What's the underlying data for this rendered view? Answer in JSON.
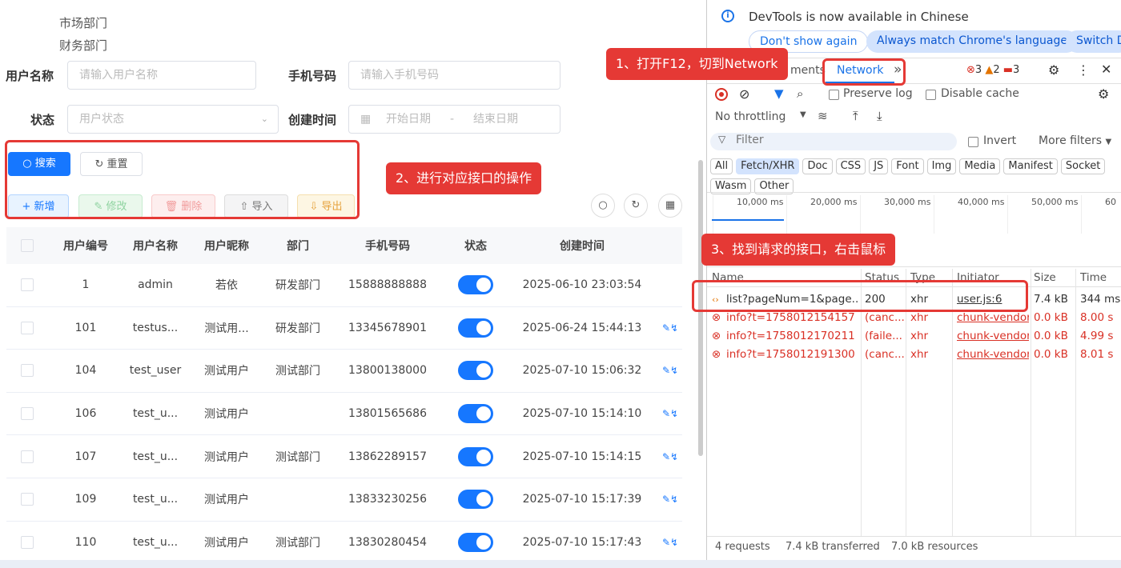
{
  "tree": {
    "items": [
      "市场部门",
      "财务部门"
    ]
  },
  "form": {
    "username_label": "用户名称",
    "username_placeholder": "请输入用户名称",
    "phone_label": "手机号码",
    "phone_placeholder": "请输入手机号码",
    "status_label": "状态",
    "status_placeholder": "用户状态",
    "created_label": "创建时间",
    "start_placeholder": "开始日期",
    "date_sep": "-",
    "end_placeholder": "结束日期"
  },
  "buttons": {
    "search": "搜索",
    "reset": "重置",
    "add": "新增",
    "edit": "修改",
    "delete": "删除",
    "import": "导入",
    "export": "导出"
  },
  "callouts": {
    "step1": "1、打开F12，切到Network",
    "step2": "2、进行对应接口的操作",
    "step3": "3、找到请求的接口，右击鼠标"
  },
  "table": {
    "headers": [
      "用户编号",
      "用户名称",
      "用户昵称",
      "部门",
      "手机号码",
      "状态",
      "创建时间"
    ],
    "rows": [
      {
        "id": "1",
        "name": "admin",
        "nick": "若依",
        "dept": "研发部门",
        "phone": "15888888888",
        "time": "2025-06-10 23:03:54"
      },
      {
        "id": "101",
        "name": "testus...",
        "nick": "测试用...",
        "dept": "研发部门",
        "phone": "13345678901",
        "time": "2025-06-24 15:44:13"
      },
      {
        "id": "104",
        "name": "test_user",
        "nick": "测试用户",
        "dept": "测试部门",
        "phone": "13800138000",
        "time": "2025-07-10 15:06:32"
      },
      {
        "id": "106",
        "name": "test_u...",
        "nick": "测试用户",
        "dept": "",
        "phone": "13801565686",
        "time": "2025-07-10 15:14:10"
      },
      {
        "id": "107",
        "name": "test_u...",
        "nick": "测试用户",
        "dept": "测试部门",
        "phone": "13862289157",
        "time": "2025-07-10 15:14:15"
      },
      {
        "id": "109",
        "name": "test_u...",
        "nick": "测试用户",
        "dept": "",
        "phone": "13833230256",
        "time": "2025-07-10 15:17:39"
      },
      {
        "id": "110",
        "name": "test_u...",
        "nick": "测试用户",
        "dept": "测试部门",
        "phone": "13830280454",
        "time": "2025-07-10 15:17:43"
      }
    ]
  },
  "devtools": {
    "banner": "DevTools is now available in Chinese",
    "dont_show": "Don't show again",
    "always_match": "Always match Chrome's language",
    "switch": "Switch D",
    "tab_elements_partial": "ments",
    "tab_network": "Network",
    "more_tabs": "»",
    "errors": "3",
    "warnings": "2",
    "messages": "3",
    "preserve_log": "Preserve log",
    "disable_cache": "Disable cache",
    "throttling": "No throttling",
    "filter_placeholder": "Filter",
    "invert": "Invert",
    "more_filters": "More filters",
    "type_filters": [
      "All",
      "Fetch/XHR",
      "Doc",
      "CSS",
      "JS",
      "Font",
      "Img",
      "Media",
      "Manifest",
      "Socket",
      "Wasm",
      "Other"
    ],
    "timeline_ticks": [
      "10,000 ms",
      "20,000 ms",
      "30,000 ms",
      "40,000 ms",
      "50,000 ms",
      "60"
    ],
    "columns": [
      "Name",
      "Status",
      "Type",
      "Initiator",
      "Size",
      "Time"
    ],
    "requests": [
      {
        "name": "list?pageNum=1&page...",
        "status": "200",
        "type": "xhr",
        "initiator": "user.js:6",
        "size": "7.4 kB",
        "time": "344 ms",
        "error": false
      },
      {
        "name": "info?t=1758012154157",
        "status": "(canc...",
        "type": "xhr",
        "initiator": "chunk-vendors",
        "size": "0.0 kB",
        "time": "8.00 s",
        "error": true
      },
      {
        "name": "info?t=1758012170211",
        "status": "(faile...",
        "type": "xhr",
        "initiator": "chunk-vendors",
        "size": "0.0 kB",
        "time": "4.99 s",
        "error": true
      },
      {
        "name": "info?t=1758012191300",
        "status": "(canc...",
        "type": "xhr",
        "initiator": "chunk-vendors",
        "size": "0.0 kB",
        "time": "8.01 s",
        "error": true
      }
    ],
    "summary": {
      "requests": "4 requests",
      "transferred": "7.4 kB transferred",
      "resources": "7.0 kB resources"
    }
  },
  "colors": {
    "accent": "#1677ff",
    "callout": "#e53935"
  }
}
